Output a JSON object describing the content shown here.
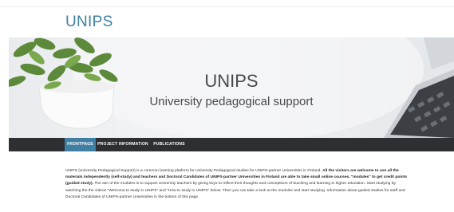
{
  "site": {
    "logo_text": "UNIPS"
  },
  "hero": {
    "title": "UNIPS",
    "subtitle": "University pedagogical support"
  },
  "nav": {
    "items": [
      {
        "label": "FRONTPAGE",
        "active": true
      },
      {
        "label": "PROJECT INFORMATION",
        "active": false
      },
      {
        "label": "PUBLICATIONS",
        "active": false
      }
    ]
  },
  "intro": {
    "part1": "UNIPS (University Pedagogical Support) is a common learning platform for University Pedagogical studies for UNIPS-partner Universities in Finland. ",
    "bold1": "All the visitors are welcome to use all the materials independently (self-study) and teachers and Doctoral Candidates of UNIPS-partner Universities in Finland are able to take small online courses, \"modules\" to get credit points (guided study).",
    "part2": " The aim of the modules is to support University teachers by giving keys to reflect their thoughts and conceptions of teaching and learning in higher education. Start studying by watching the the videos \"Welcome to study in UNIPS\" and \"How to study in UNIPS\" below. Then you can take a look at the modules and start studying. Information about guided studies for staff and Doctoral Candidates of UNIPS-partner Universities in the bottom of this page."
  },
  "colors": {
    "brand": "#3f7fa3",
    "nav_bg": "#2d2f33"
  }
}
